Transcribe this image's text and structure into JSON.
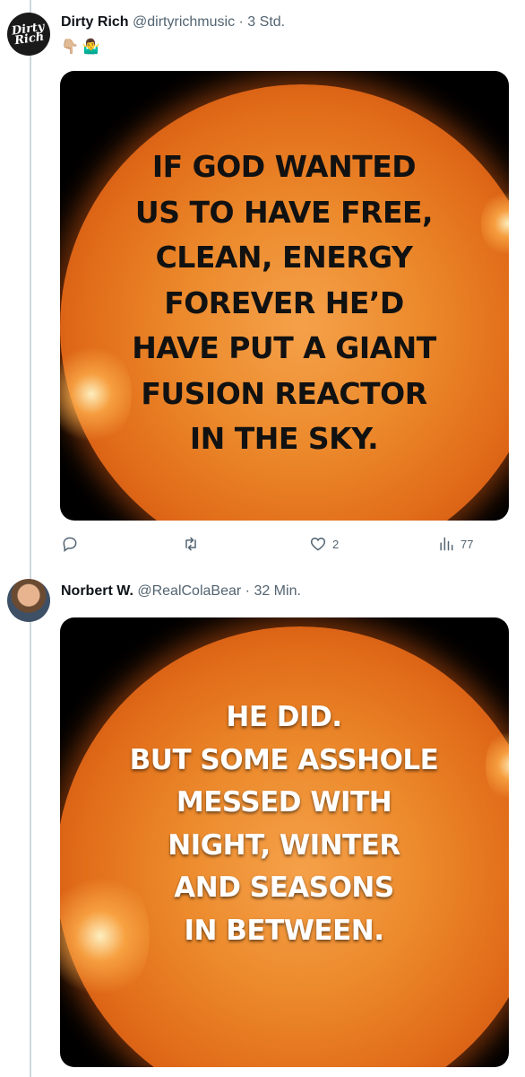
{
  "tweet1": {
    "name": "Dirty Rich",
    "handle": "@dirtyrichmusic",
    "separator": "·",
    "time": "3 Std.",
    "emojis": [
      "👇🏼",
      "🤷‍♂️"
    ],
    "avatar_text": "Dirty Rich",
    "meme_lines": [
      "IF GOD WANTED",
      "US TO HAVE FREE,",
      "CLEAN, ENERGY",
      "FOREVER HE’D",
      "HAVE PUT A GIANT",
      "FUSION REACTOR",
      "IN THE SKY."
    ],
    "stats": {
      "replies": "",
      "retweets": "",
      "likes": "2",
      "views": "77"
    }
  },
  "tweet2": {
    "name": "Norbert W.",
    "handle": "@RealColaBear",
    "separator": "·",
    "time": "32 Min.",
    "meme_lines": [
      "HE DID.",
      "BUT SOME ASSHOLE",
      "MESSED WITH",
      "NIGHT, WINTER",
      "AND SEASONS",
      "IN BETWEEN."
    ]
  },
  "icons": {
    "reply": "reply-icon",
    "retweet": "retweet-icon",
    "like": "heart-icon",
    "views": "views-icon"
  },
  "colors": {
    "secondary_text": "#536471",
    "thread_line": "#cfd9de"
  }
}
